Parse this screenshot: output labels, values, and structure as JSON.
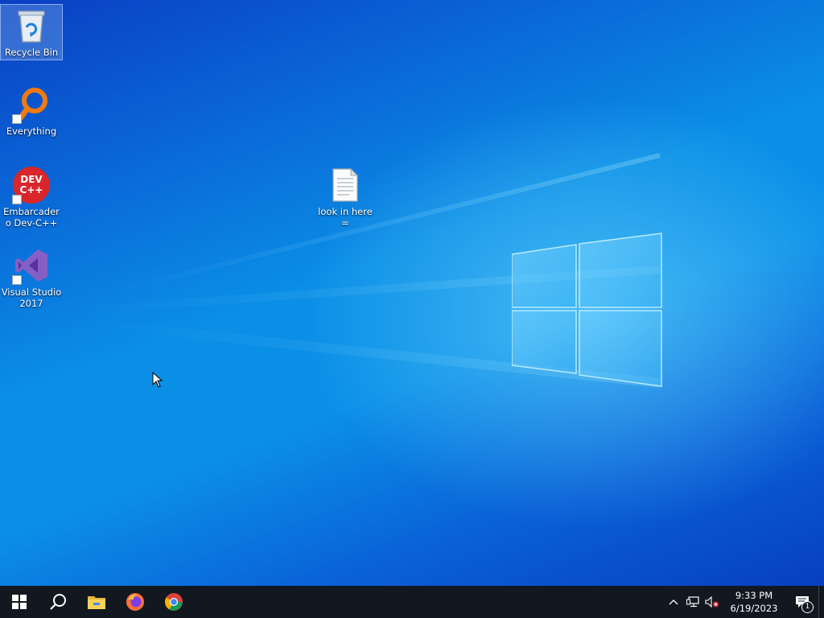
{
  "desktop": {
    "icons": [
      {
        "label": "Recycle Bin",
        "icon": "recycle-bin-icon"
      },
      {
        "label": "Everything",
        "icon": "everything-search-icon"
      },
      {
        "label": "Embarcadero Dev-C++",
        "icon": "devcpp-icon",
        "glyph_text": "DEV C++"
      },
      {
        "label": "Visual Studio 2017",
        "icon": "visual-studio-icon"
      },
      {
        "label": "look in here =",
        "icon": "text-file-icon"
      }
    ]
  },
  "taskbar": {
    "start": {
      "icon": "windows-start-icon"
    },
    "search": {
      "icon": "search-icon"
    },
    "pinned": [
      {
        "name": "File Explorer",
        "icon": "file-explorer-icon"
      },
      {
        "name": "Firefox",
        "icon": "firefox-icon"
      },
      {
        "name": "Google Chrome",
        "icon": "chrome-icon"
      }
    ],
    "tray": {
      "icons": [
        "chevron-up-icon",
        "network-icon",
        "volume-muted-icon"
      ],
      "time": "9:33 PM",
      "date": "6/19/2023",
      "notification_count": "1"
    }
  },
  "colors": {
    "taskbar": "#111820",
    "desktop_blue": "#0a8ee6",
    "dev_red": "#d8262b",
    "vs_purple": "#865fc5",
    "everything_orange": "#f07a10"
  }
}
